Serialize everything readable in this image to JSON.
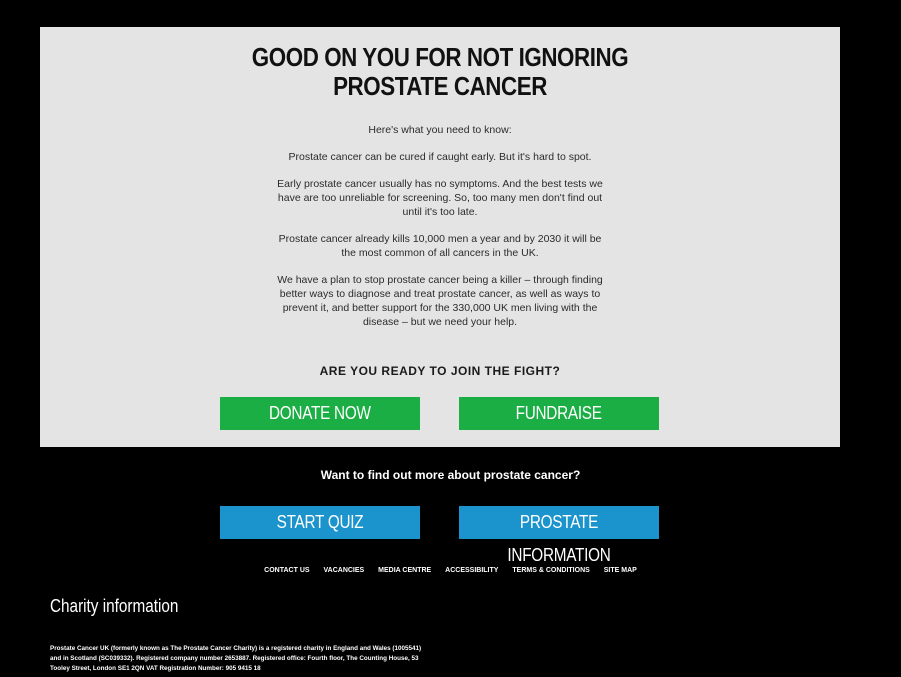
{
  "hero": {
    "headline_line1": "GOOD ON YOU FOR NOT IGNORING",
    "headline_line2": "PROSTATE CANCER",
    "paragraphs": [
      "Here's what you need to know:",
      "Prostate cancer can be cured if caught early. But it's hard to spot.",
      "Early prostate cancer usually has no symptoms. And the best tests we have are too unreliable for screening. So, too many men don't find out until it's too late.",
      "Prostate cancer already kills 10,000 men a year and by 2030 it will be the most common of all cancers in the UK.",
      "We have a plan to stop prostate cancer being a killer – through finding better ways to diagnose and treat prostate cancer, as well as ways to prevent it, and better support for the 330,000 UK men living with the disease – but we need your help."
    ],
    "cta_question": "ARE YOU READY TO JOIN THE FIGHT?",
    "donate_label": "DONATE NOW",
    "fundraise_label": "FUNDRAISE"
  },
  "more_info": {
    "question": "Want to find out more about prostate cancer?",
    "quiz_label": "START QUIZ",
    "info_label": "PROSTATE INFORMATION"
  },
  "footer": {
    "links": [
      "CONTACT US",
      "VACANCIES",
      "MEDIA CENTRE",
      "ACCESSIBILITY",
      "TERMS & CONDITIONS",
      "SITE MAP"
    ],
    "charity_title": "Charity information",
    "charity_text": "Prostate Cancer UK (formerly known as The Prostate Cancer Charity) is a registered charity in England and Wales (1005541) and in Scotland (SC039332). Registered company number 2653887. Registered office: Fourth floor, The Counting House, 53 Tooley Street, London SE1 2QN VAT Registration Number: 905 9415 18"
  },
  "colors": {
    "panel_bg": "#e4e4e4",
    "page_bg": "#000000",
    "green_button": "#1aae44",
    "blue_button": "#1b93cc"
  }
}
